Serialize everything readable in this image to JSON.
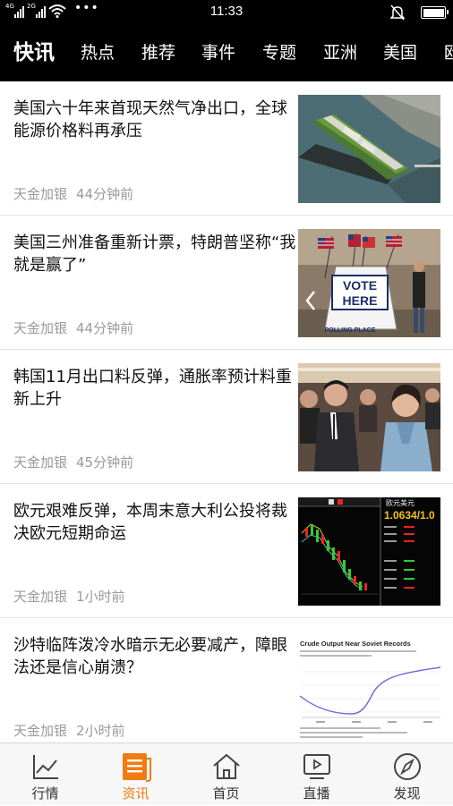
{
  "status_bar": {
    "network_1": "4G",
    "network_2": "2G",
    "time": "11:33",
    "icons": [
      "signal-icon",
      "signal-icon",
      "wifi-icon",
      "more-dots-icon",
      "bell-muted-icon",
      "battery-icon"
    ]
  },
  "nav": {
    "items": [
      "快讯",
      "热点",
      "推荐",
      "事件",
      "专题",
      "亚洲",
      "美国",
      "欧"
    ],
    "active_index": 0
  },
  "feed": {
    "items": [
      {
        "title": "美国六十年来首现天然气净出口，全球能源价格料再承压",
        "source": "天金加银",
        "time": "44分钟前",
        "thumb": "tanker-ship-photo"
      },
      {
        "title": "美国三州准备重新计票，特朗普坚称“我就是赢了”",
        "source": "天金加银",
        "time": "44分钟前",
        "thumb": "vote-here-photo"
      },
      {
        "title": "韩国11月出口料反弹，通胀率预计料重新上升",
        "source": "天金加银",
        "time": "45分钟前",
        "thumb": "people-photo"
      },
      {
        "title": "欧元艰难反弹，本周末意大利公投将裁决欧元短期命运",
        "source": "天金加银",
        "time": "1小时前",
        "thumb": "candlestick-chart-photo"
      },
      {
        "title": "沙特临阵泼冷水暗示无必要减产，障眼法还是信心崩溃？",
        "source": "天金加银",
        "time": "2小时前",
        "thumb": "line-chart-photo"
      }
    ],
    "thumb_texts": {
      "vote_line1": "VOTE",
      "vote_line2": "HERE",
      "polling": "POLLING PLACE",
      "chart_title": "Crude Output Near Soviet Records",
      "fx_title": "欧元美元",
      "fx_price": "1.0634/1.0"
    }
  },
  "tabbar": {
    "tabs": [
      {
        "label": "行情",
        "icon": "market-chart-icon"
      },
      {
        "label": "资讯",
        "icon": "news-doc-icon"
      },
      {
        "label": "首页",
        "icon": "home-icon"
      },
      {
        "label": "直播",
        "icon": "live-play-icon"
      },
      {
        "label": "发现",
        "icon": "discover-compass-icon"
      }
    ],
    "active_index": 1,
    "accent_color": "#f07b12"
  }
}
